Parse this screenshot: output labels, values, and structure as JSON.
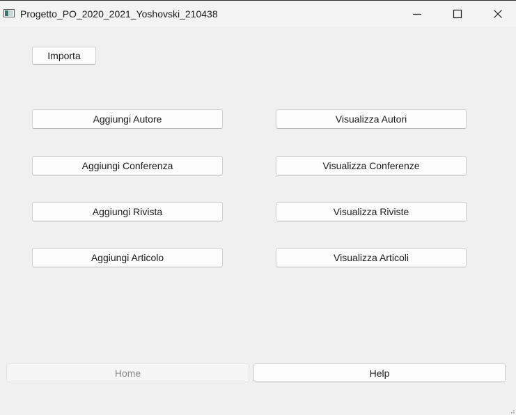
{
  "window": {
    "title": "Progetto_PO_2020_2021_Yoshovski_210438"
  },
  "toolbar": {
    "import_label": "Importa"
  },
  "left_column": [
    {
      "label": "Aggiungi Autore"
    },
    {
      "label": "Aggiungi Conferenza"
    },
    {
      "label": "Aggiungi Rivista"
    },
    {
      "label": "Aggiungi Articolo"
    }
  ],
  "right_column": [
    {
      "label": "Visualizza Autori"
    },
    {
      "label": "Visualizza Conferenze"
    },
    {
      "label": "Visualizza Riviste"
    },
    {
      "label": "Visualizza Articoli"
    }
  ],
  "bottom_bar": {
    "home_label": "Home",
    "home_state": "disabled",
    "help_label": "Help"
  },
  "icons": {
    "app": "app-window-icon",
    "minimize": "minimize-icon",
    "maximize": "maximize-icon",
    "close": "close-icon",
    "resize": "resize-grip-icon"
  }
}
